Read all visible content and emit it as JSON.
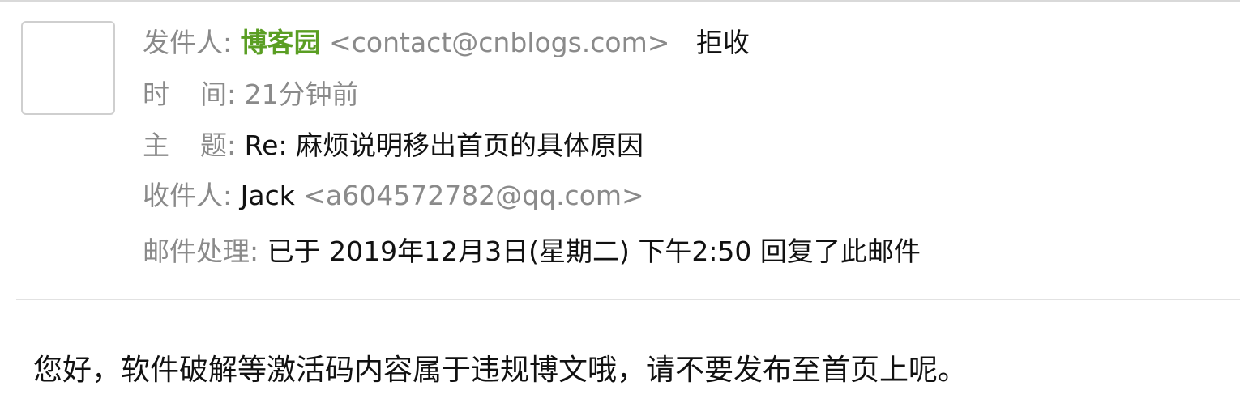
{
  "header": {
    "from_label": "发件人:",
    "sender_name": "博客园",
    "sender_email": "<contact@cnblogs.com>",
    "reject_label": "拒收",
    "time_label_1": "时",
    "time_label_2": "间:",
    "time_value": "21分钟前",
    "subject_label_1": "主",
    "subject_label_2": "题:",
    "subject_value": "Re: 麻烦说明移出首页的具体原因",
    "to_label": "收件人:",
    "recipient_name": "Jack",
    "recipient_email": "<a604572782@qq.com>",
    "handle_label": "邮件处理:",
    "handle_value": "已于 2019年12月3日(星期二) 下午2:50 回复了此邮件"
  },
  "body": {
    "text": "您好，软件破解等激活码内容属于违规博文哦，请不要发布至首页上呢。"
  },
  "colors": {
    "sender_name": "#5a9e23",
    "label": "#8a8a8a",
    "text": "#111111"
  }
}
